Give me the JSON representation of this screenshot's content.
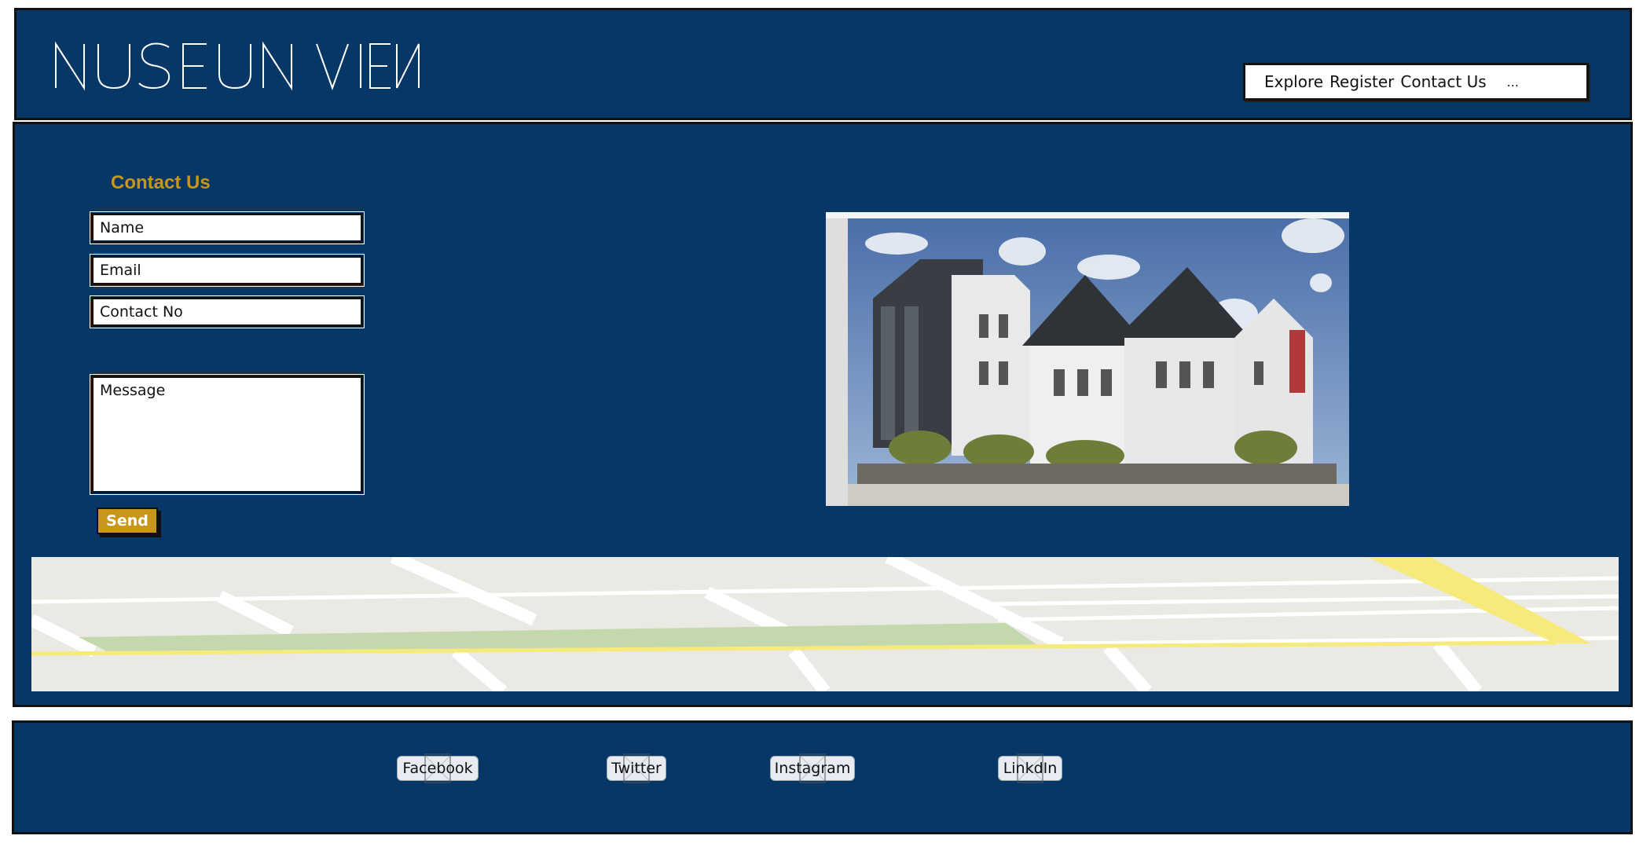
{
  "header": {
    "logo_text": "MUSEUM VIEW",
    "nav": {
      "items": [
        "Explore",
        "Register",
        "Contact Us"
      ],
      "more": "..."
    }
  },
  "contact": {
    "title": "Contact Us",
    "name_placeholder": "Name",
    "email_placeholder": "Email",
    "contact_placeholder": "Contact No",
    "message_placeholder": "Message",
    "send_label": "Send"
  },
  "footer": {
    "links": [
      "Facebook",
      "Twitter",
      "Instagram",
      "LinkdIn"
    ]
  },
  "colors": {
    "panel": "#063766",
    "accent": "#c8971a"
  }
}
